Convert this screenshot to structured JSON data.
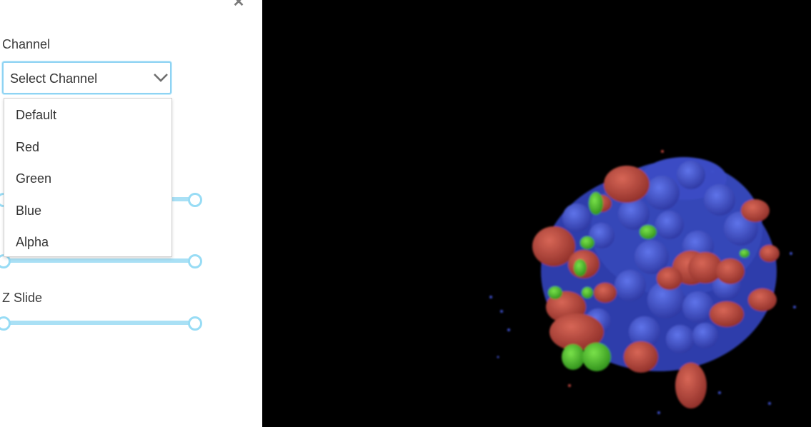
{
  "panel": {
    "close_icon": "close-icon",
    "channel_label": "Channel",
    "channel_select": {
      "value": "Select Channel",
      "icon": "chevron-down-icon",
      "options": [
        "Default",
        "Red",
        "Green",
        "Blue",
        "Alpha"
      ]
    },
    "z_slide_label": "Z Slide"
  },
  "viewer": {
    "content": "3d-volume-render",
    "colors": {
      "red": "#b5423a",
      "green": "#49c02a",
      "blue": "#3d4fc9",
      "background": "#000000"
    }
  }
}
